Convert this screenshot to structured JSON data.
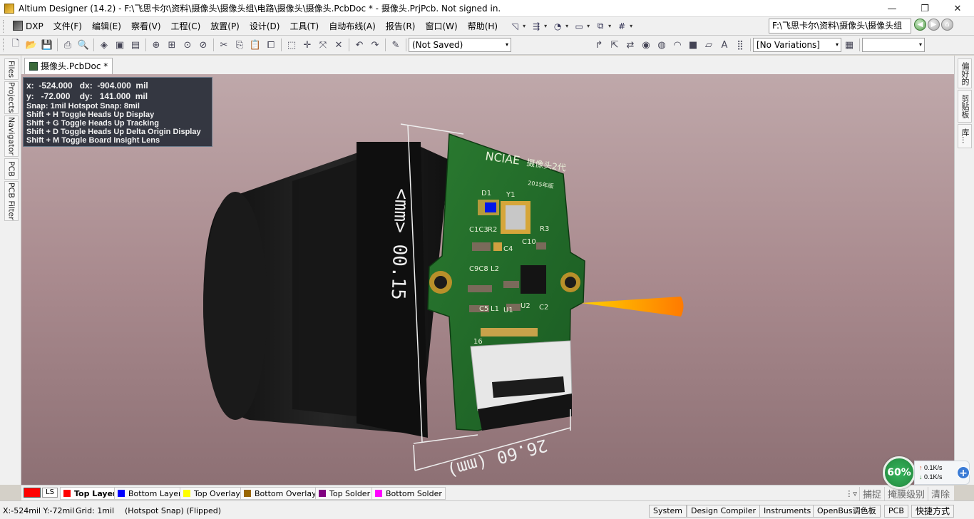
{
  "window": {
    "title": "Altium Designer (14.2) - F:\\飞思卡尔\\资料\\摄像头\\摄像头组\\电路\\摄像头\\摄像头.PcbDoc * - 摄像头.PrjPcb. Not signed in.",
    "minimize": "—",
    "restore": "❐",
    "close": "✕"
  },
  "menu": {
    "items": [
      "DXP",
      "文件(F)",
      "编辑(E)",
      "察看(V)",
      "工程(C)",
      "放置(P)",
      "设计(D)",
      "工具(T)",
      "自动布线(A)",
      "报告(R)",
      "窗口(W)",
      "帮助(H)"
    ],
    "path_combo": "F:\\飞思卡尔\\资料\\摄像头\\摄像头组",
    "path_combo_arrow": "▾"
  },
  "toolbar": {
    "saved_state": "(Not Saved)",
    "variations": "[No Variations]",
    "combo_arrow": "▾"
  },
  "left_dock": {
    "tabs": [
      "Files",
      "Projects",
      "Navigator",
      "PCB",
      "PCB Filter"
    ]
  },
  "right_dock": {
    "tabs": [
      "偏好的",
      "剪贴板",
      "库..."
    ]
  },
  "document": {
    "tab_label": "摄像头.PcbDoc *"
  },
  "hud": {
    "line1": "x:  -524.000   dx:  -904.000  mil",
    "line2": "y:   -72.000    dy:   141.000  mil",
    "snap": "Snap: 1mil Hotspot Snap: 8mil",
    "shortcuts": [
      "Shift + H   Toggle Heads Up Display",
      "Shift + G   Toggle Heads Up Tracking",
      "Shift + D   Toggle Heads Up Delta Origin Display",
      "Shift + M  Toggle Board Insight Lens"
    ]
  },
  "board": {
    "brand": "NCIAE",
    "brand_cn": "摄像头2代",
    "year": "2015年版",
    "dim_vertical": "<mm> 00.15",
    "dim_horizontal": "26.60 (mm)",
    "refs": [
      "D1",
      "Y1",
      "C1C3",
      "R2",
      "R3",
      "C4",
      "C10",
      "C9C8",
      "L2",
      "L1",
      "C5",
      "U1",
      "U2",
      "C2",
      "16"
    ]
  },
  "layers": {
    "ls_label": "LS",
    "ls_color": "#ff0000",
    "tabs": [
      {
        "label": "Top Layer",
        "color": "#ff0000",
        "active": true
      },
      {
        "label": "Bottom Layer",
        "color": "#0000ff",
        "active": false
      },
      {
        "label": "Top Overlay",
        "color": "#ffff00",
        "active": false
      },
      {
        "label": "Bottom Overlay",
        "color": "#996600",
        "active": false
      },
      {
        "label": "Top Solder",
        "color": "#800080",
        "active": false
      },
      {
        "label": "Bottom Solder",
        "color": "#ff00ff",
        "active": false
      }
    ],
    "snap_btn": "捕捉",
    "mask_btn": "掩膜级别",
    "clear_btn": "清除"
  },
  "status": {
    "coords": "X:-524mil Y:-72mil",
    "grid": "Grid: 1mil",
    "mode": "(Hotspot Snap) (Flipped)",
    "buttons": [
      "System",
      "Design Compiler",
      "Instruments",
      "OpenBus调色板",
      "PCB",
      "快捷方式"
    ]
  },
  "net_widget": {
    "percent": "60%",
    "up": "0.1K/s",
    "down": "0.1K/s",
    "plus": "+",
    "up_arrow": "↑",
    "down_arrow": "↓"
  },
  "colors": {
    "pcb_green": "#1f6a28",
    "viewport_top": "#bfa8aa",
    "viewport_bottom": "#8d7074",
    "hud_bg": "#282e38"
  }
}
